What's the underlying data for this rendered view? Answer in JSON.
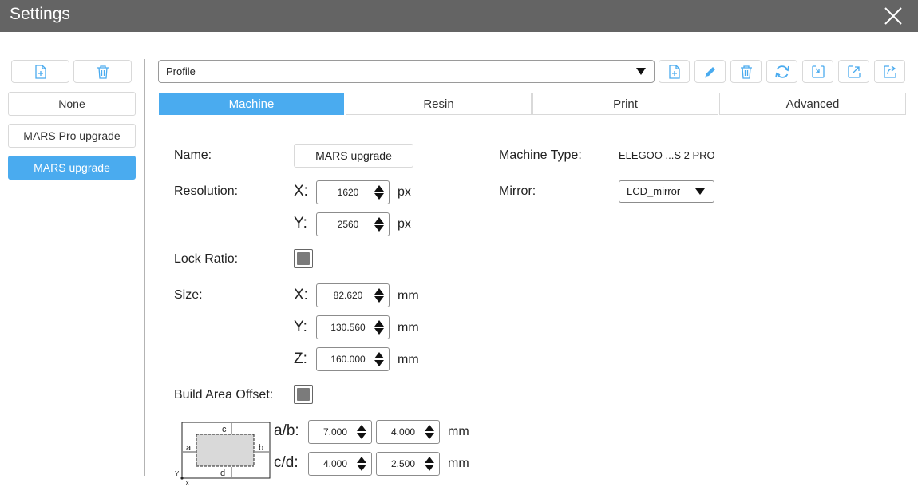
{
  "window": {
    "title": "Settings"
  },
  "sidebar": {
    "items": [
      {
        "label": "None"
      },
      {
        "label": "MARS Pro upgrade"
      },
      {
        "label": "MARS upgrade"
      }
    ]
  },
  "profile": {
    "label": "Profile"
  },
  "tabs": [
    {
      "label": "Machine"
    },
    {
      "label": "Resin"
    },
    {
      "label": "Print"
    },
    {
      "label": "Advanced"
    }
  ],
  "machine": {
    "name_label": "Name:",
    "name_value": "MARS upgrade",
    "resolution_label": "Resolution:",
    "res_x_axis": "X:",
    "res_x_value": "1620",
    "res_y_axis": "Y:",
    "res_y_value": "2560",
    "px_unit": "px",
    "lock_ratio_label": "Lock Ratio:",
    "size_label": "Size:",
    "size_x_axis": "X:",
    "size_x_value": "82.620",
    "size_y_axis": "Y:",
    "size_y_value": "130.560",
    "size_z_axis": "Z:",
    "size_z_value": "160.000",
    "mm_unit": "mm",
    "build_offset_label": "Build Area Offset:",
    "ab_label": "a/b:",
    "a_value": "7.000",
    "b_value": "4.000",
    "cd_label": "c/d:",
    "c_value": "4.000",
    "d_value": "2.500",
    "machine_type_label": "Machine Type:",
    "machine_type_value": "ELEGOO ...S 2 PRO",
    "mirror_label": "Mirror:",
    "mirror_value": "LCD_mirror",
    "diagram": {
      "a": "a",
      "b": "b",
      "c": "c",
      "d": "d",
      "y": "Y",
      "x": "X"
    }
  },
  "colors": {
    "accent": "#4aabef",
    "titlebar": "#646464"
  }
}
